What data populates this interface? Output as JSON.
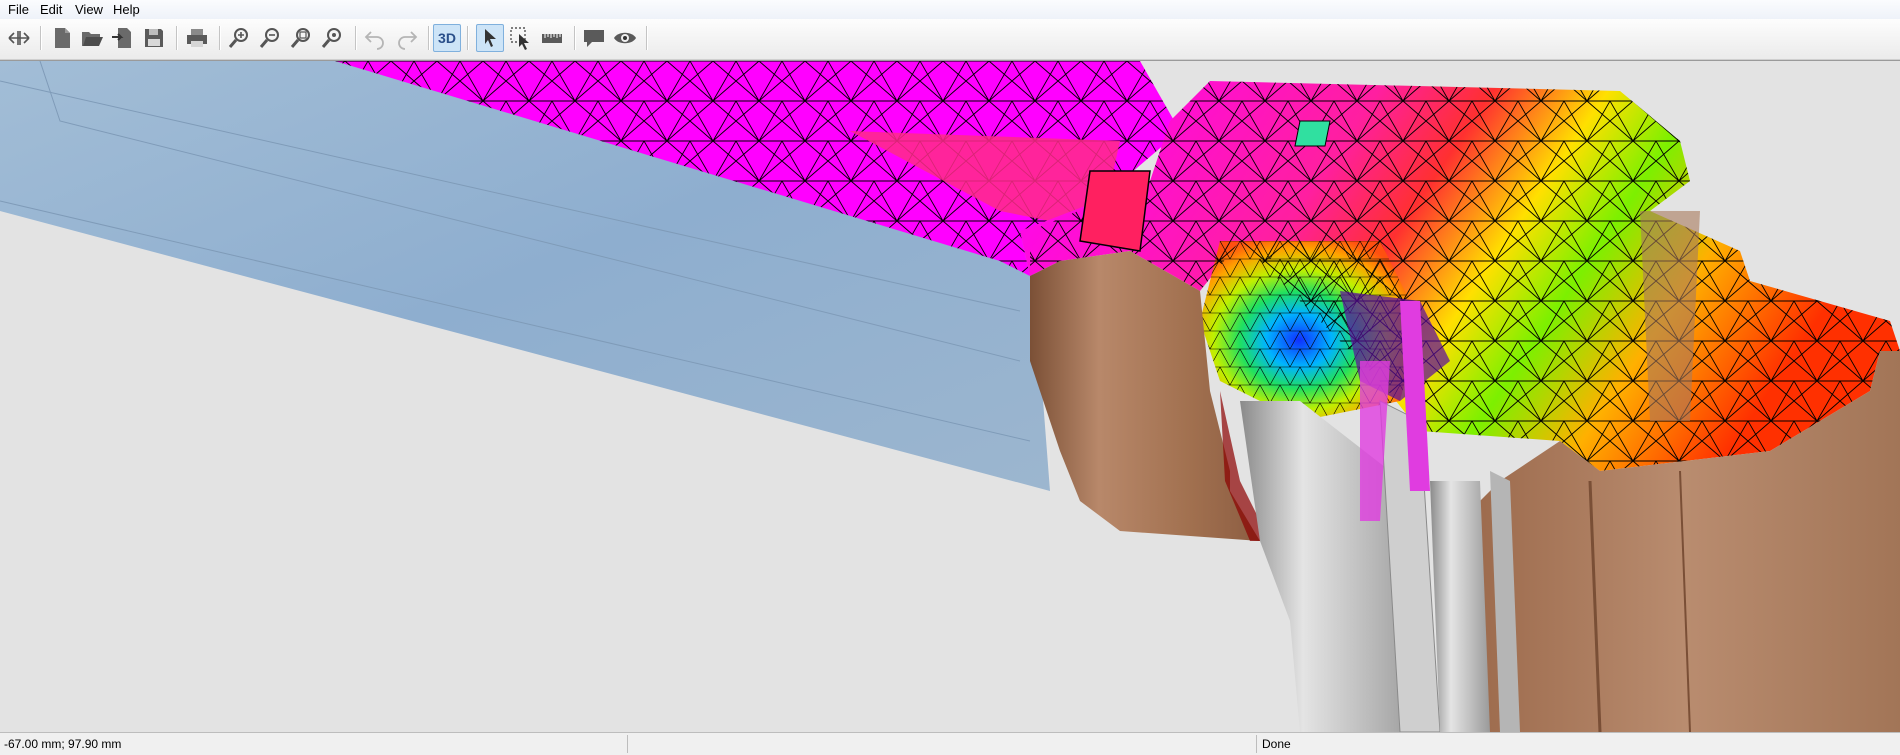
{
  "menu": {
    "items": [
      "File",
      "Edit",
      "View",
      "Help"
    ]
  },
  "toolbar": {
    "mode_3d_label": "3D"
  },
  "status": {
    "coordinates": "-67.00 mm; 97.90 mm",
    "state": "Done"
  },
  "colors": {
    "glass": "#8fb0d0",
    "wood": "#a4755a",
    "aluminum": "#c8c8c8",
    "background": "#e3e3e3",
    "mesh_lines": "#000000"
  }
}
